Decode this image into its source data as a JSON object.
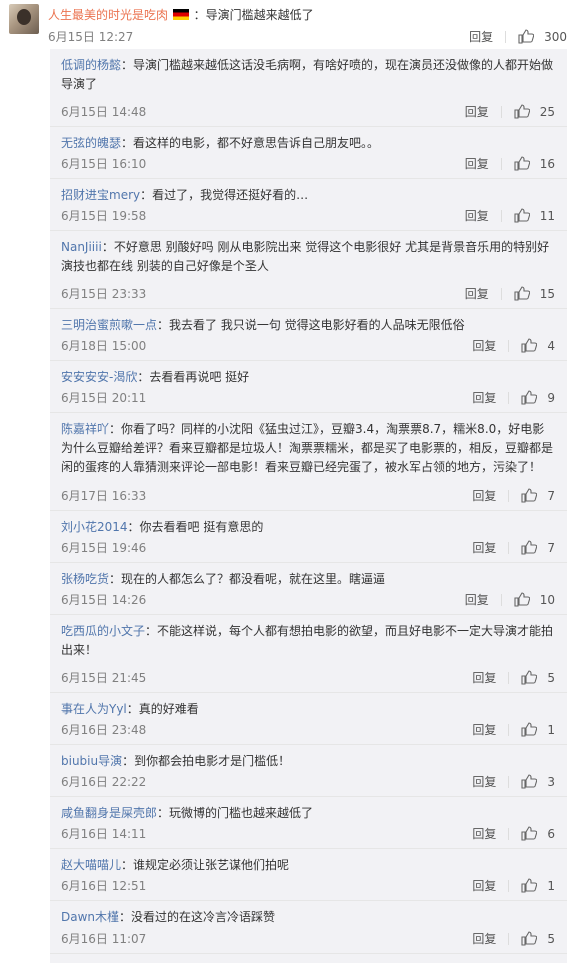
{
  "top_comment": {
    "user": "人生最美的时光是吃肉",
    "text": "：导演门槛越来越低了",
    "time": "6月15日 12:27",
    "reply_label": "回复",
    "likes": "300"
  },
  "replies": [
    {
      "user": "低调的杨懿",
      "text": "：导演门槛越来越低这话没毛病啊，有啥好喷的，现在演员还没做像的人都开始做导演了",
      "time": "6月15日 14:48",
      "likes": "25",
      "tall": true
    },
    {
      "user": "无弦的魄瑟",
      "text": "：看这样的电影，都不好意思告诉自己朋友吧。。",
      "time": "6月15日 16:10",
      "likes": "16"
    },
    {
      "user": "招财进宝mery",
      "text": "：看过了，我觉得还挺好看的…",
      "time": "6月15日 19:58",
      "likes": "11"
    },
    {
      "user": "NanJiiii",
      "text": "：不好意思 别酸好吗 刚从电影院出来 觉得这个电影很好 尤其是背景音乐用的特别好 演技也都在线 别装的自己好像是个圣人",
      "time": "6月15日 23:33",
      "likes": "15",
      "tall": true
    },
    {
      "user": "三明治蜜煎嗽一点",
      "text": "：我去看了 我只说一句 觉得这电影好看的人品味无限低俗",
      "time": "6月18日 15:00",
      "likes": "4"
    },
    {
      "user": "安安安安-渴欣",
      "text": "：去看看再说吧 挺好",
      "time": "6月15日 20:11",
      "likes": "9"
    },
    {
      "user": "陈嘉祥吖",
      "text": "：你看了吗？同样的小沈阳《猛虫过江》，豆瓣3.4，淘票票8.7，糯米8.0，好电影为什么豆瓣给差评？看来豆瓣都是垃圾人！淘票票糯米，都是买了电影票的，相反，豆瓣都是闲的蛋疼的人靠猜测来评论一部电影！看来豆瓣已经完蛋了，被水军占领的地方，污染了！",
      "time": "6月17日 16:33",
      "likes": "7",
      "tall": true,
      "extra_tall": true
    },
    {
      "user": "刘小花2014",
      "text": "：你去看看吧 挺有意思的",
      "time": "6月15日 19:46",
      "likes": "7"
    },
    {
      "user": "张杨吃货",
      "text": "：现在的人都怎么了？都没看呢，就在这里。瞎逼逼",
      "time": "6月15日 14:26",
      "likes": "10"
    },
    {
      "user": "吃西瓜的小文子",
      "text": "：不能这样说，每个人都有想拍电影的欲望，而且好电影不一定大导演才能拍出来！",
      "time": "6月15日 21:45",
      "likes": "5",
      "tall": true
    },
    {
      "user": "事在人为Yyl",
      "text": "：真的好难看",
      "time": "6月16日 23:48",
      "likes": "1"
    },
    {
      "user": "biubiu导演",
      "text": "：到你都会拍电影才是门槛低！",
      "time": "6月16日 22:22",
      "likes": "3"
    },
    {
      "user": "咸鱼翻身是屎壳郎",
      "text": "：玩微博的门槛也越来越低了",
      "time": "6月16日 14:11",
      "likes": "6"
    },
    {
      "user": "赵大喵喵儿",
      "text": "：谁规定必须让张艺谋他们拍呢",
      "time": "6月16日 12:51",
      "likes": "1"
    },
    {
      "user": "Dawn木槿",
      "text": "：没看过的在这冷言冷语踩赞",
      "time": "6月16日 11:07",
      "likes": "5"
    }
  ],
  "reply_label": "回复",
  "colors": {
    "link": "#5176ac",
    "top_user": "#eb7350",
    "panel_bg": "#f2f2f5"
  }
}
